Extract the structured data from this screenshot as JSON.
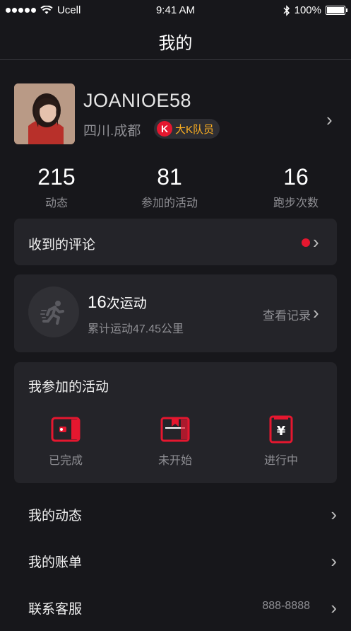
{
  "status_bar": {
    "carrier": "Ucell",
    "time": "9:41 AM",
    "battery": "100%"
  },
  "nav": {
    "title": "我的"
  },
  "profile": {
    "username": "JOANIOE58",
    "location": "四川.成都",
    "badge_icon": "K",
    "badge_label": "大K队员"
  },
  "stats": [
    {
      "value": "215",
      "label": "动态"
    },
    {
      "value": "81",
      "label": "参加的活动"
    },
    {
      "value": "16",
      "label": "跑步次数"
    }
  ],
  "comments": {
    "label": "收到的评论"
  },
  "exercise": {
    "count": "16",
    "count_suffix": "次运动",
    "total": "累计运动47.45公里",
    "link": "查看记录"
  },
  "activities": {
    "title": "我参加的活动",
    "items": [
      {
        "label": "已完成",
        "icon": "wallet-icon"
      },
      {
        "label": "未开始",
        "icon": "bookmark-icon"
      },
      {
        "label": "进行中",
        "icon": "yen-icon"
      }
    ]
  },
  "menu": [
    {
      "label": "我的动态",
      "value": ""
    },
    {
      "label": "我的账单",
      "value": ""
    },
    {
      "label": "联系客服",
      "value": "888-8888"
    }
  ],
  "colors": {
    "accent": "#e5172f",
    "background": "#17171b",
    "card": "#242429",
    "badge_text": "#ffb020"
  }
}
